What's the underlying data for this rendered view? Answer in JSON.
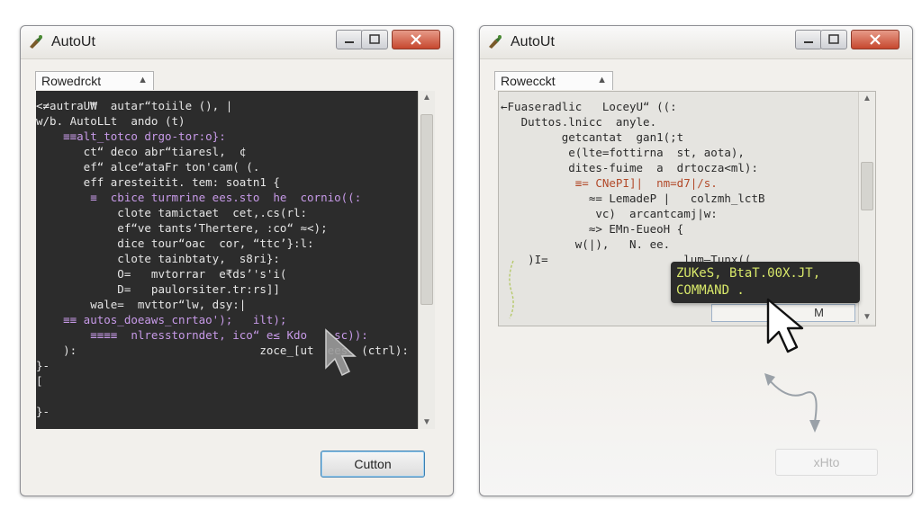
{
  "left_window": {
    "title": "AutoUt",
    "combo_label": "Rowedrckt",
    "code_lines": [
      "<≠autraU₩  autar“toiile (), |",
      "w/b. AutoLLt  ando (t)",
      "    ≡≡alt_totco drgo-tor:o}:",
      "       ct“ deco abr“tiaresl,  ¢",
      "       ef“ alce“ataFr ton'cam( (.",
      "       eff aresteitit. tem: soatn1 {",
      "        ≡  cbice turmrine ees.sto  he  cornio((:",
      "            clote tamictaet  cet,.cs(rl:",
      "            ef“ve tants‘Thertere, :co“ ≈<);",
      "            dice tour“oac  cor, “ttc’}:l:",
      "            clote tainbtaty,  s8ri}:",
      "            O=   mvtorrar  e₹ds’'s'i(",
      "            D=   paulorsiter.tr:rs]]",
      "        wale=  mvttor“lw, dsy:|",
      "    ≡≡ autos_doeaws_cnrtao');   ilt);",
      "        ≡≡≡≡  nlresstorndet, ico“ e≤ Kdo    sc)):",
      "    ):                           zoce_[ut  ees  (ctrl):",
      "}-",
      "[",
      "",
      "}-"
    ],
    "button_label": "Cutton"
  },
  "right_window": {
    "title": "AutoUt",
    "combo_label": "Rowecckt",
    "code_lines": [
      "←Fuaseradlic   LoceyU“ ((:",
      "   Duttos.lnicc  anyle.",
      "         getcantat  gan1(;t",
      "          e(lte=fottirna  st, aota),",
      "          dites-fuime  a  drtocza<ml):",
      "           ≡= CNePI]|  nm=d7|/s.",
      "             ≈= LemadeP |   colzmh_lctB",
      "              vc)  arcantcamj|w:",
      "             ≈> EMn-EueoH {",
      "           w(|),   N. ee.",
      "    )I=                    lum—Tunx((",
      "                                   ---"
    ],
    "tooltip_lines": [
      "ZUKeS, BtaT.00X.JT,",
      "COMMAND ."
    ],
    "field_text": "M",
    "button_label": "xHto"
  },
  "colors": {
    "editor_dark": "#2c2c2c",
    "editor_light": "#e5e4e0",
    "tooltip_text": "#d8e86a",
    "close_button": "#c6472e",
    "button_focus": "#3c7fb1"
  }
}
